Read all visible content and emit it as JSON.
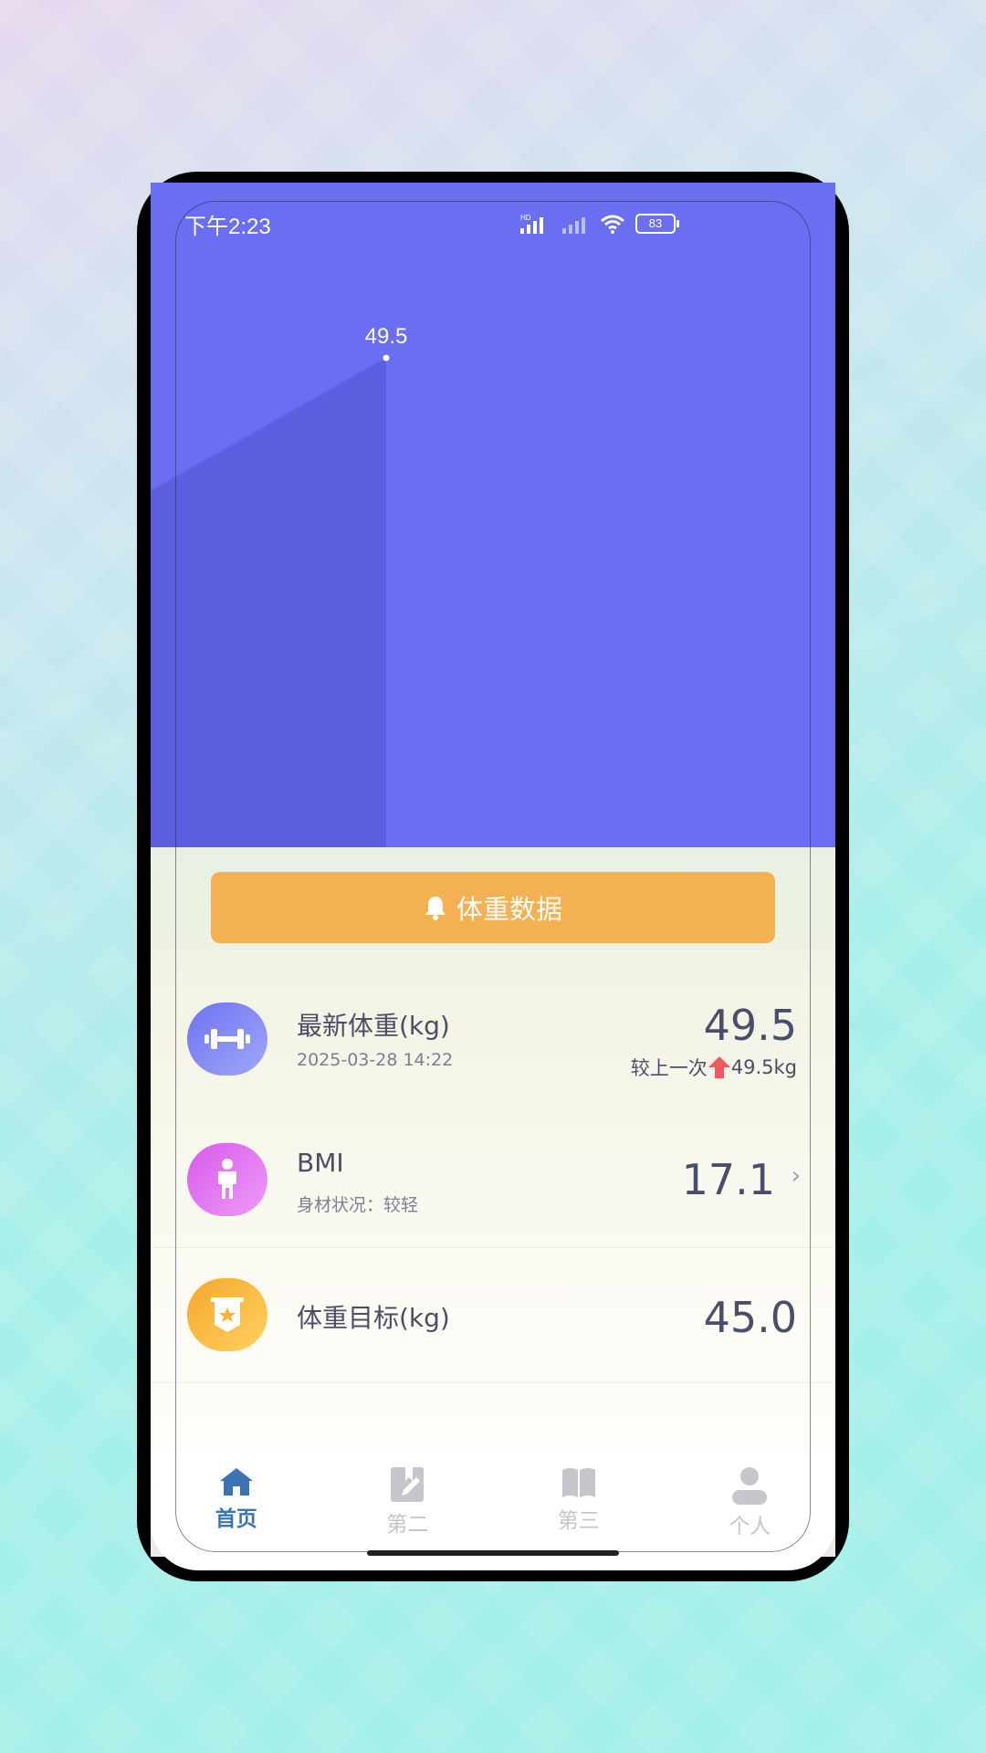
{
  "status": {
    "time": "下午2:23",
    "battery": "83",
    "network_label": "HD"
  },
  "chart": {
    "point_value": "49.5",
    "point_fraction_x": 0.34,
    "fill_color": "#5a5fe0",
    "bg_color": "#6a6ff2"
  },
  "header_button": {
    "label": "体重数据",
    "icon": "bell-icon",
    "color": "#f3b152"
  },
  "rows": [
    {
      "title": "最新体重(kg)",
      "subtitle": "2025-03-28 14:22",
      "value": "49.5",
      "note_prefix": "较上一次",
      "note_value": "49.5kg",
      "icon": "dumbbell-icon"
    },
    {
      "title": "BMI",
      "subtitle": "身材状况：较轻",
      "value": "17.1",
      "icon": "person-icon"
    },
    {
      "title": "体重目标(kg)",
      "subtitle": "",
      "value": "45.0",
      "icon": "goal-flag-icon"
    }
  ],
  "tabs": [
    {
      "label": "首页",
      "icon": "home-icon",
      "active": true
    },
    {
      "label": "第二",
      "icon": "edit-document-icon",
      "active": false
    },
    {
      "label": "第三",
      "icon": "book-icon",
      "active": false
    },
    {
      "label": "个人",
      "icon": "user-icon",
      "active": false
    }
  ],
  "colors": {
    "accent": "#3a74b5",
    "inactive": "#c4c6cc",
    "text_dark": "#4a4e6a"
  }
}
